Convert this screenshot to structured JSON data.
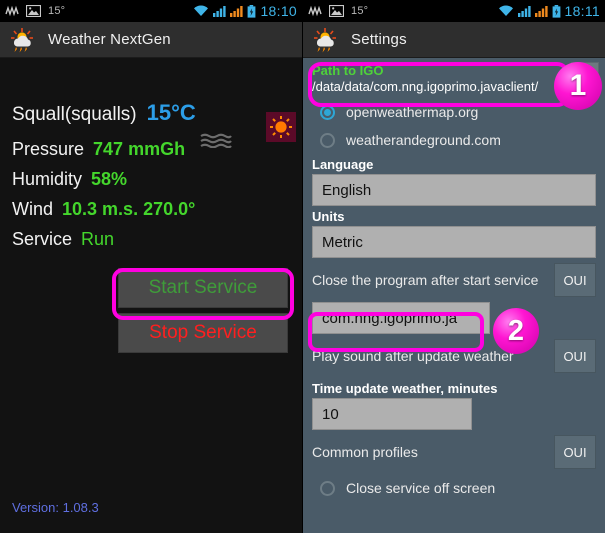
{
  "left": {
    "statusbar": {
      "icons": [
        "activity-icon",
        "image-icon"
      ],
      "temp": "15°",
      "wifi": "wifi-icon",
      "signal1": "signal-icon",
      "signal2": "signal-icon",
      "battery": "battery-icon",
      "time": "18:10"
    },
    "titlebar": {
      "icon": "weather-storm-icon",
      "title": "Weather NextGen"
    },
    "weather": {
      "condition_label": "Squall(squalls)",
      "temperature": "15°C",
      "condition_icon": "sun-icon",
      "squall_icon": "wave-lines-icon",
      "rows": [
        {
          "label": "Pressure",
          "value": "747 mmGh"
        },
        {
          "label": "Humidity",
          "value": "58%"
        },
        {
          "label": "Wind",
          "value": "10.3 m.s.  270.0°"
        },
        {
          "label": "Service",
          "value": "Run"
        }
      ]
    },
    "buttons": {
      "start": "Start Service",
      "stop": "Stop Service"
    },
    "version": "Version: 1.08.3"
  },
  "right": {
    "statusbar": {
      "temp": "15°",
      "time": "18:11"
    },
    "titlebar": {
      "icon": "weather-storm-icon",
      "title": "Settings"
    },
    "path_pref": {
      "title": "Path to IGO",
      "value": "/data/data/com.nng.igoprimo.javaclient/",
      "browse_button": "P"
    },
    "providers": [
      {
        "label": "openweathermap.org",
        "selected": true
      },
      {
        "label": "weatherandeground.com",
        "selected": false
      }
    ],
    "language": {
      "label": "Language",
      "value": "English"
    },
    "units": {
      "label": "Units",
      "value": "Metric"
    },
    "close_after_start": {
      "label": "Close the program after start service",
      "button": "OUI"
    },
    "package_field": {
      "value": "com.nng.igoprimo.ja"
    },
    "play_sound": {
      "label": "Play sound after update weather",
      "button": "OUI"
    },
    "time_update": {
      "label": "Time update weather, minutes",
      "value": "10"
    },
    "common_profiles": {
      "label": "Common profiles",
      "button": "OUI"
    },
    "close_off_screen": {
      "label": "Close service off screen",
      "selected": false
    },
    "badges": {
      "one": "1",
      "two": "2"
    }
  },
  "colors": {
    "highlight": "#ff00e0",
    "accent_green": "#44d62c",
    "accent_blue": "#2c9ee8",
    "panel_bg": "#4a5b68"
  }
}
